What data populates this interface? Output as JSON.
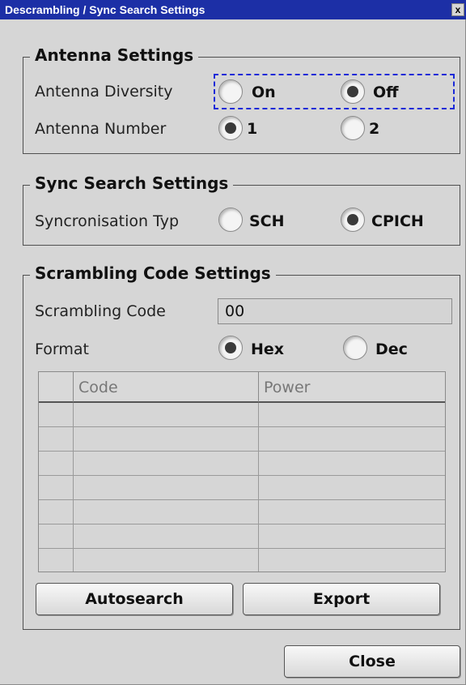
{
  "window": {
    "title": "Descrambling / Sync Search Settings",
    "close_glyph": "x"
  },
  "antenna": {
    "title": "Antenna Settings",
    "diversity_label": "Antenna Diversity",
    "diversity_options": [
      {
        "label": "On",
        "checked": false
      },
      {
        "label": "Off",
        "checked": true
      }
    ],
    "number_label": "Antenna Number",
    "number_options": [
      {
        "label": "1",
        "checked": true
      },
      {
        "label": "2",
        "checked": false
      }
    ]
  },
  "sync": {
    "title": "Sync Search Settings",
    "type_label": "Syncronisation Typ",
    "type_options": [
      {
        "label": "SCH",
        "checked": false
      },
      {
        "label": "CPICH",
        "checked": true
      }
    ]
  },
  "scrambling": {
    "title": "Scrambling Code Settings",
    "code_label": "Scrambling Code",
    "code_value": "00",
    "format_label": "Format",
    "format_options": [
      {
        "label": "Hex",
        "checked": true
      },
      {
        "label": "Dec",
        "checked": false
      }
    ],
    "table": {
      "columns": [
        "",
        "Code",
        "Power"
      ],
      "empty_rows": 7
    },
    "autosearch_label": "Autosearch",
    "export_label": "Export"
  },
  "footer": {
    "close_label": "Close"
  }
}
